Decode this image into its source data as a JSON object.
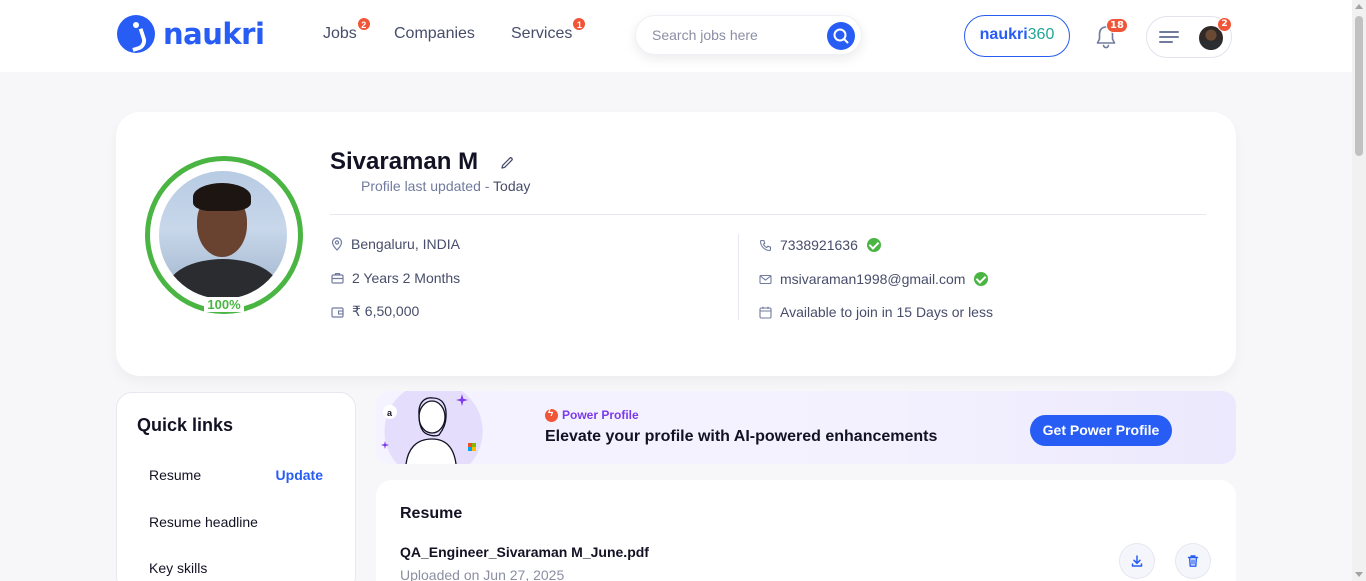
{
  "header": {
    "logo_text": "naukri",
    "nav": [
      {
        "label": "Jobs",
        "badge": "2"
      },
      {
        "label": "Companies",
        "badge": ""
      },
      {
        "label": "Services",
        "badge": "1"
      }
    ],
    "search_placeholder": "Search jobs here",
    "naukri360_a": "naukri",
    "naukri360_b": "360",
    "notifications_badge": "18",
    "avatar_badge": "2"
  },
  "profile": {
    "name": "Sivaraman M",
    "updated_label": "Profile last updated - ",
    "updated_value": "Today",
    "completion": "100%",
    "location": "Bengaluru, INDIA",
    "experience": "2 Years 2 Months",
    "salary": "₹ 6,50,000",
    "phone": "7338921636",
    "email": "msivaraman1998@gmail.com",
    "notice": "Available to join in 15 Days or less"
  },
  "quick_links": {
    "title": "Quick links",
    "items": [
      {
        "label": "Resume",
        "action": "Update"
      },
      {
        "label": "Resume headline",
        "action": ""
      },
      {
        "label": "Key skills",
        "action": ""
      }
    ]
  },
  "power_profile": {
    "label": "Power Profile",
    "title": "Elevate your profile with AI-powered enhancements",
    "button": "Get Power Profile"
  },
  "resume": {
    "title": "Resume",
    "file_name": "QA_Engineer_Sivaraman M_June.pdf",
    "uploaded": "Uploaded on Jun 27, 2025"
  },
  "colors": {
    "brand": "#275df5",
    "success": "#4ab543",
    "badge": "#f05537",
    "power_accent": "#7c3aed"
  }
}
